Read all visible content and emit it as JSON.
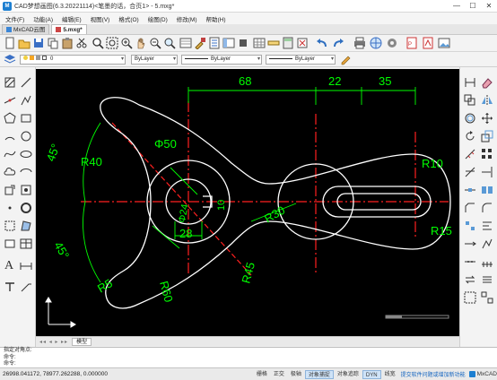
{
  "window": {
    "title": "CAD梦想画图(6.3.20221114)<笔墨的话，合页1> - 5.mxg*",
    "minimize": "—",
    "maximize": "☐",
    "close": "✕"
  },
  "menu": [
    "文件(F)",
    "功能(A)",
    "编辑(E)",
    "视图(V)",
    "格式(O)",
    "绘图(D)",
    "修改(M)",
    "帮助(H)"
  ],
  "tabs": [
    {
      "label": "MxCAD云图",
      "active": false
    },
    {
      "label": "5.mxg*",
      "active": true
    }
  ],
  "layer_toolbar": {
    "layer_value": "0",
    "color_value": "ByLayer",
    "linetype_value": "ByLayer",
    "lineweight_value": "ByLayer"
  },
  "layout_tabs": {
    "arrows": "◂◂ ◂ ▸ ▸▸",
    "model": "模型"
  },
  "command": {
    "line1": "指定对角点:",
    "line2": "命令:",
    "line3": "命令:"
  },
  "status": {
    "coords": "26998.041172,  78977.262288,  0.000000",
    "buttons": [
      {
        "label": "栅格",
        "on": false
      },
      {
        "label": "正交",
        "on": false
      },
      {
        "label": "极轴",
        "on": false
      },
      {
        "label": "对象捕捉",
        "on": true
      },
      {
        "label": "对象追踪",
        "on": false
      },
      {
        "label": "DYN",
        "on": true
      },
      {
        "label": "线宽",
        "on": false
      }
    ],
    "link": "提交软件问题或增加新功能",
    "brand": "MxCAD"
  },
  "drawing": {
    "dimensions": [
      "68",
      "22",
      "35",
      "Φ50",
      "R40",
      "R10",
      "R30",
      "R15",
      "Φ24",
      "28",
      "10",
      "45°",
      "45°",
      "R5",
      "R60",
      "R45"
    ],
    "colors": {
      "geometry": "#ffffff",
      "dimensions": "#00ff00",
      "centerline": "#ff2020",
      "background": "#000000"
    }
  }
}
